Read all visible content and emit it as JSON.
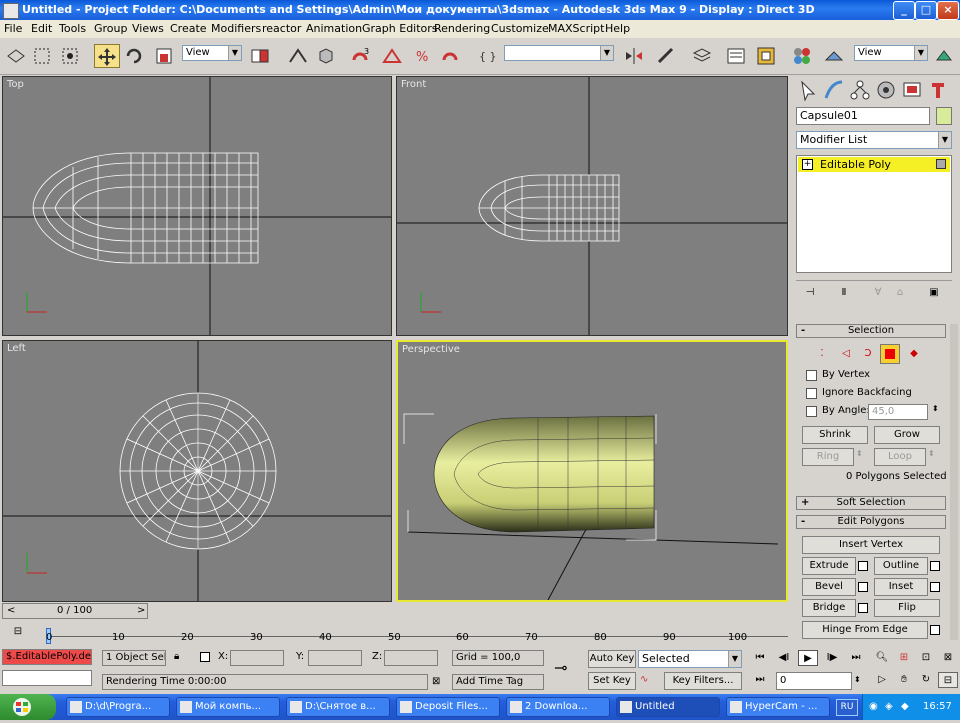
{
  "window": {
    "title": "Untitled    - Project Folder: C:\\Documents and Settings\\Admin\\Мои документы\\3dsmax     - Autodesk 3ds Max 9     - Display : Direct 3D",
    "controls": [
      "_",
      "□",
      "×"
    ]
  },
  "menu": [
    "File",
    "Edit",
    "Tools",
    "Group",
    "Views",
    "Create",
    "Modifiers",
    "reactor",
    "Animation",
    "Graph Editors",
    "Rendering",
    "Customize",
    "MAXScript",
    "Help"
  ],
  "toolbar": {
    "ref_coord": "View",
    "named_selection": "",
    "view_dropdown_right": "View"
  },
  "viewports": {
    "top": "Top",
    "front": "Front",
    "left": "Left",
    "perspective": "Perspective"
  },
  "command_panel": {
    "object_name": "Capsule01",
    "object_color": "#d7eb9b",
    "modifier_list": "Modifier List",
    "stack": [
      {
        "label": "Editable Poly"
      }
    ],
    "selection": {
      "header": "Selection",
      "by_vertex": "By Vertex",
      "ignore_backfacing": "Ignore Backfacing",
      "by_angle": "By Angle:",
      "angle_value": "45,0",
      "shrink": "Shrink",
      "grow": "Grow",
      "ring": "Ring",
      "loop": "Loop",
      "status": "0 Polygons Selected"
    },
    "soft_selection": "Soft Selection",
    "edit_polygons": {
      "header": "Edit Polygons",
      "insert_vertex": "Insert Vertex",
      "extrude": "Extrude",
      "outline": "Outline",
      "bevel": "Bevel",
      "inset": "Inset",
      "bridge": "Bridge",
      "flip": "Flip",
      "hinge": "Hinge From Edge"
    }
  },
  "timeline": {
    "slider": "0 / 100",
    "ticks": [
      "0",
      "10",
      "20",
      "30",
      "40",
      "50",
      "60",
      "70",
      "80",
      "90",
      "100"
    ]
  },
  "status": {
    "maxscript": "$.EditablePoly.de",
    "selection_count": "1 Object Sele",
    "x_label": "X:",
    "y_label": "Y:",
    "z_label": "Z:",
    "grid": "Grid = 100,0",
    "rendering_time": "Rendering Time  0:00:00",
    "add_time_tag": "Add Time Tag",
    "auto_key": "Auto Key",
    "auto_key_value": "Selected",
    "set_key": "Set Key",
    "key_filters": "Key Filters...",
    "frame": "0"
  },
  "taskbar": {
    "tasks": [
      "D:\\d\\Progra...",
      "Мой компь...",
      "D:\\Снятое в...",
      "Deposit Files...",
      "2 Downloa...",
      "Untitled",
      "HyperCam - ..."
    ],
    "lang": "RU",
    "clock": "16:57"
  }
}
